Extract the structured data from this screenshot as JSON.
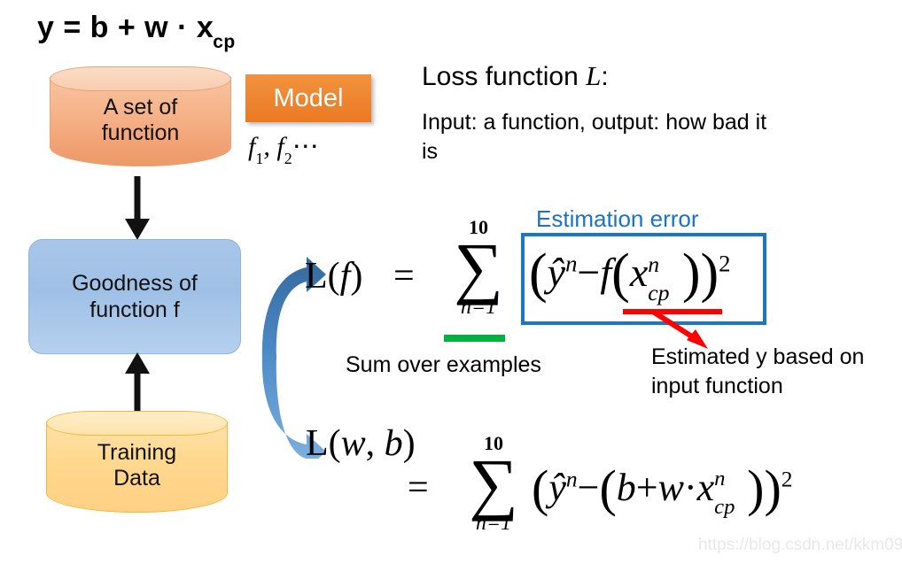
{
  "slide": {
    "title_equation": {
      "main": "y = b + w · x",
      "subscript": "cp"
    },
    "watermark": "https://blog.csdn.net/kkm09"
  },
  "flow": {
    "set_of_function": "A set of\nfunction",
    "set_of_function_line1": "A set of",
    "set_of_function_line2": "function",
    "goodness_line1": "Goodness of",
    "goodness_line2": "function f",
    "training_line1": "Training",
    "training_line2": "Data",
    "arrow_down": "down-arrow",
    "arrow_up": "up-arrow"
  },
  "model": {
    "label": "Model",
    "functions_f": "f",
    "functions_sub1": "1",
    "functions_comma": ", f",
    "functions_sub2": "2",
    "functions_dots": "⋯"
  },
  "loss": {
    "heading_prefix": "Loss function ",
    "heading_symbol": "L",
    "heading_suffix": ":",
    "description": "Input: a function, output: how bad it is"
  },
  "annotations": {
    "estimation_error": "Estimation error",
    "sum_over_examples": "Sum over examples",
    "estimated_y": "Estimated y based on input function",
    "green_color": "#00b140",
    "red_color": "#ff0000",
    "blue_color": "#1a76c8",
    "label_blue": "#1a73c4"
  },
  "formula1": {
    "lhs": "L(f)",
    "lhs_up": "L",
    "lhs_paren_open": "(",
    "lhs_var": "f",
    "lhs_paren_close": ")",
    "equals": "=",
    "sigma_upper": "10",
    "sigma_glyph": "∑",
    "sigma_lower": "n=1",
    "body_open": "(",
    "body_yhat": "ŷ",
    "body_yhat_sup": "n",
    "body_minus": "−",
    "body_f": "f",
    "body_inner_open": "(",
    "body_x": "x",
    "body_x_sup": "n",
    "body_x_sub": "cp",
    "body_inner_close": ")",
    "body_close": ")",
    "body_power": "2"
  },
  "formula2": {
    "lhs_up": "L",
    "lhs_paren_open": "(",
    "lhs_w": "w",
    "lhs_comma": ", ",
    "lhs_b": "b",
    "lhs_paren_close": ")",
    "equals": "=",
    "sigma_upper": "10",
    "sigma_glyph": "∑",
    "sigma_lower": "n=1",
    "body_open": "(",
    "body_yhat": "ŷ",
    "body_yhat_sup": "n",
    "body_minus": "−",
    "body_inner_open": "(",
    "body_b": "b",
    "body_plus": "+",
    "body_w": "w",
    "body_dot": "·",
    "body_x": "x",
    "body_x_sup": "n",
    "body_x_sub": "cp",
    "body_inner_close": ")",
    "body_close": ")",
    "body_power": "2"
  },
  "colors": {
    "orange_cylinder": "#f2a375",
    "orange_model": "#ee8430",
    "blue_box": "#9fc0e6",
    "yellow_cylinder": "#ffd98f",
    "arrow_blue": "#4a88c7"
  }
}
